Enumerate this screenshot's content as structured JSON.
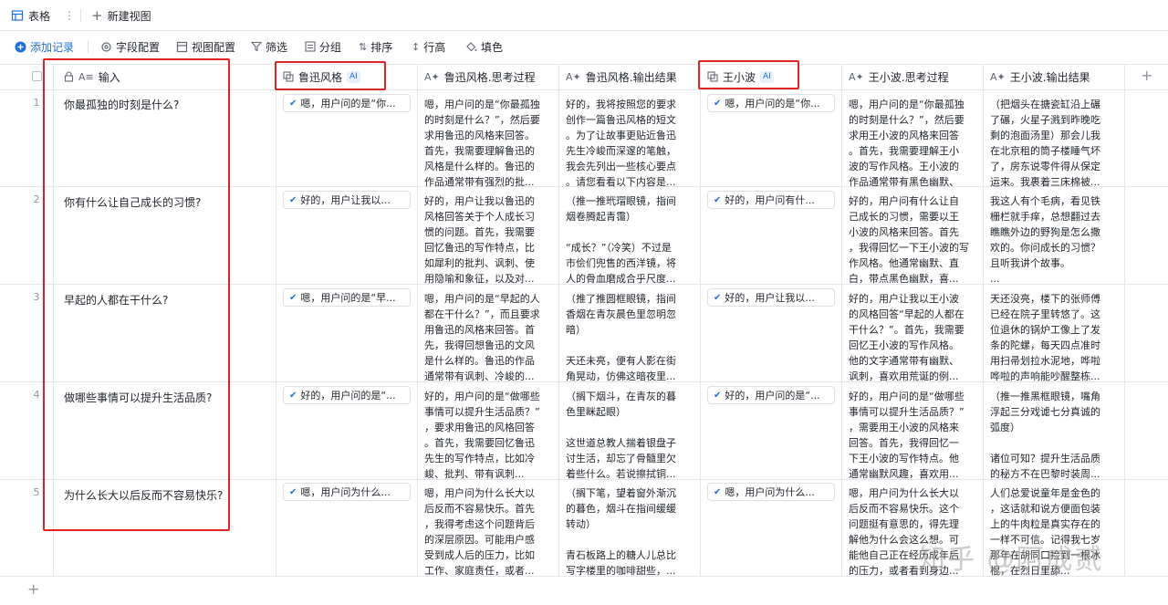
{
  "tabs": [
    {
      "label": "表格"
    },
    {
      "label": "新建视图"
    }
  ],
  "toolbar": {
    "add_record": "添加记录",
    "field_config": "字段配置",
    "view_config": "视图配置",
    "filter": "筛选",
    "group": "分组",
    "sort": "排序",
    "row_height": "行高",
    "fill": "填色"
  },
  "columns": [
    {
      "label": "输入",
      "type_hint": "A≡"
    },
    {
      "label": "鲁迅风格",
      "badge": "AI"
    },
    {
      "label": "鲁迅风格.思考过程"
    },
    {
      "label": "鲁迅风格.输出结果"
    },
    {
      "label": "王小波",
      "badge": "AI"
    },
    {
      "label": "王小波.思考过程"
    },
    {
      "label": "王小波.输出结果"
    }
  ],
  "rows": [
    {
      "num": "1",
      "input": "你最孤独的时刻是什么?",
      "lx_chip": "嗯，用户问的是“你...",
      "lx_think": "嗯，用户问的是“你最孤独\n的时刻是什么？”，然后要\n求用鲁迅的风格来回答。\n首先，我需要理解鲁迅的\n风格是什么样的。鲁迅的\n作品通常带有强烈的批...",
      "lx_out": "好的，我将按照您的要求\n创作一篇鲁迅风格的短文\n。为了让故事更贴近鲁迅\n先生冷峻而深邃的笔触，\n我会先列出一些核心要点\n。请您看看以下内容是...",
      "wxb_chip": "嗯，用户问的是“你...",
      "wxb_think": "嗯，用户问的是“你最孤独\n的时刻是什么？”，然后要\n求用王小波的风格来回答\n。首先，我需要理解王小\n波的写作风格。王小波的\n作品通常带有黑色幽默、讽...",
      "wxb_out": "（把烟头在搪瓷缸沿上碾\n了碾，火星子溅到昨晚吃\n剩的泡面汤里）那会儿我\n在北京租的筒子楼睡气坏\n了，房东说零件得从保定\n运来。我裹着三床棉被..."
    },
    {
      "num": "2",
      "input": "你有什么让自己成长的习惯?",
      "lx_chip": "好的，用户让我以...",
      "lx_think": "好的，用户让我以鲁迅的\n风格回答关于个人成长习\n惯的问题。首先，我需要\n回忆鲁迅的写作特点，比\n如犀利的批判、讽刺、使\n用隐喻和象征，以及对...",
      "lx_out": "（推一推玳瑁眼镜，指间\n烟卷腾起青霭）\n\n“成长？”（冷笑）不过是\n市侩们兜售的西洋镜，将\n人的骨血磨成合乎尺度...",
      "wxb_chip": "好的，用户问有什...",
      "wxb_think": "好的，用户问有什么让自\n己成长的习惯，需要以王\n小波的风格来回答。首先\n，我得回忆一下王小波的写\n作风格。他通常幽默、直\n白，带点黑色幽默，喜...",
      "wxb_out": "我这人有个毛病，看见铁\n栅栏就手痒，总想翻过去\n瞧瞧外边的野狗是怎么撒\n欢的。你问成长的习惯？\n且听我讲个故事。\n..."
    },
    {
      "num": "3",
      "input": "早起的人都在干什么?",
      "lx_chip": "嗯，用户问的是“早...",
      "lx_think": "嗯，用户问的是“早起的人\n都在干什么？”，而且要求\n用鲁迅的风格来回答。首\n先，我得回想鲁迅的文风\n是什么样的。鲁迅的作品\n通常带有讽刺、冷峻的...",
      "lx_out": "（推了推圆框眼镜，指间\n香烟在青灰晨色里忽明忽\n暗）\n\n天还未亮，便有人影在街\n角晃动，仿佛这暗夜里...",
      "wxb_chip": "好的，用户让我以...",
      "wxb_think": "好的，用户让我以王小波\n的风格回答“早起的人都在\n干什么？”。首先，我需要\n回忆王小波的写作风格。\n他的文字通常带有幽默、\n讽刺，喜欢用荒诞的例...",
      "wxb_out": "天还没亮，楼下的张师傅\n已经在院子里转悠了。这\n位退休的锅炉工像上了发\n条的陀螺，每天四点准时\n用扫帚划拉水泥地，哗啦\n哗啦的声响能吵醒整栋..."
    },
    {
      "num": "4",
      "input": "做哪些事情可以提升生活品质?",
      "lx_chip": "好的，用户问的是“...",
      "lx_think": "好的，用户问的是“做哪些\n事情可以提升生活品质？”\n，要求用鲁迅的风格回答\n。首先，我需要回忆鲁迅\n先生的写作特点，比如冷\n峻、批判、带有讽刺...",
      "lx_out": "（搁下烟斗，在青灰的暮\n色里眯起眼）\n\n这世道总教人揣着银盘子\n讨生活，却忘了骨髓里欠\n着些什么。若说擦拭铜...",
      "wxb_chip": "好的，用户问的是“...",
      "wxb_think": "好的，用户问的是“做哪些\n事情可以提升生活品质？”\n，需要用王小波的风格来\n回答。首先，我得回忆一\n下王小波的写作特点。他\n通常幽默风趣，喜欢用...",
      "wxb_out": "（推一推黑框眼镜，嘴角\n浮起三分戏谑七分真诚的\n弧度）\n\n诸位可知？提升生活品质\n的秘方不在巴黎时装周..."
    },
    {
      "num": "5",
      "input": "为什么长大以后反而不容易快乐?",
      "lx_chip": "嗯，用户问为什么...",
      "lx_think": "嗯，用户问为什么长大以\n后反而不容易快乐。首先\n，我得考虑这个问题背后\n的深层原因。可能用户感\n受到成人后的压力，比如\n工作、家庭责任，或者...",
      "lx_out": "（搁下笔，望着窗外渐沉\n的暮色，烟斗在指间缓缓\n转动）\n\n青石板路上的糖人儿总比\n写字楼里的咖啡甜些，...",
      "wxb_chip": "嗯，用户问为什么...",
      "wxb_think": "嗯，用户问为什么长大以\n后反而不容易快乐。这个\n问题挺有意思的，得先理\n解他为什么会这么想。可\n能他自己正在经历成年后\n的压力，或者看到身边...",
      "wxb_out": "人们总爱说童年是金色的\n，这话就和说方便面包装\n上的牛肉粒是真实存在的\n一样不可信。记得我七岁\n那年在胡同口捡到一根冰\n棍，在烈日里舔..."
    }
  ],
  "watermark": "知乎 @阿成贰"
}
